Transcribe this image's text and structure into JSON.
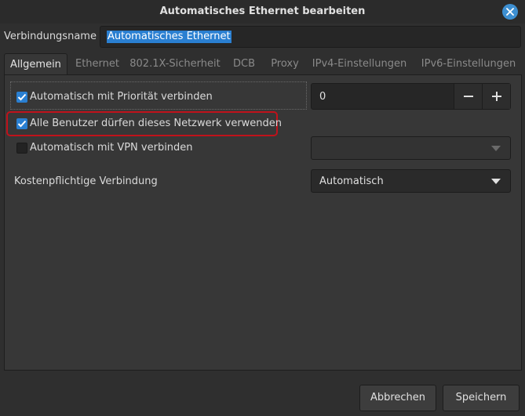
{
  "window": {
    "title": "Automatisches Ethernet bearbeiten"
  },
  "connection": {
    "label": "Verbindungsname",
    "value": "Automatisches Ethernet"
  },
  "tabs": [
    {
      "label": "Allgemein",
      "active": true
    },
    {
      "label": "Ethernet"
    },
    {
      "label": "802.1X-Sicherheit"
    },
    {
      "label": "DCB"
    },
    {
      "label": "Proxy"
    },
    {
      "label": "IPv4-Einstellungen"
    },
    {
      "label": "IPv6-Einstellungen"
    }
  ],
  "general": {
    "auto_connect_label": "Automatisch mit Priorität verbinden",
    "auto_connect_checked": true,
    "priority_value": "0",
    "all_users_label": "Alle Benutzer dürfen dieses Netzwerk verwenden",
    "all_users_checked": true,
    "vpn_label": "Automatisch mit VPN verbinden",
    "vpn_checked": false,
    "metered_label": "Kostenpflichtige Verbindung",
    "metered_value": "Automatisch"
  },
  "buttons": {
    "cancel": "Abbrechen",
    "save": "Speichern"
  },
  "colors": {
    "accent": "#2a7fd1",
    "highlight": "#c0121b",
    "background": "#373737"
  }
}
